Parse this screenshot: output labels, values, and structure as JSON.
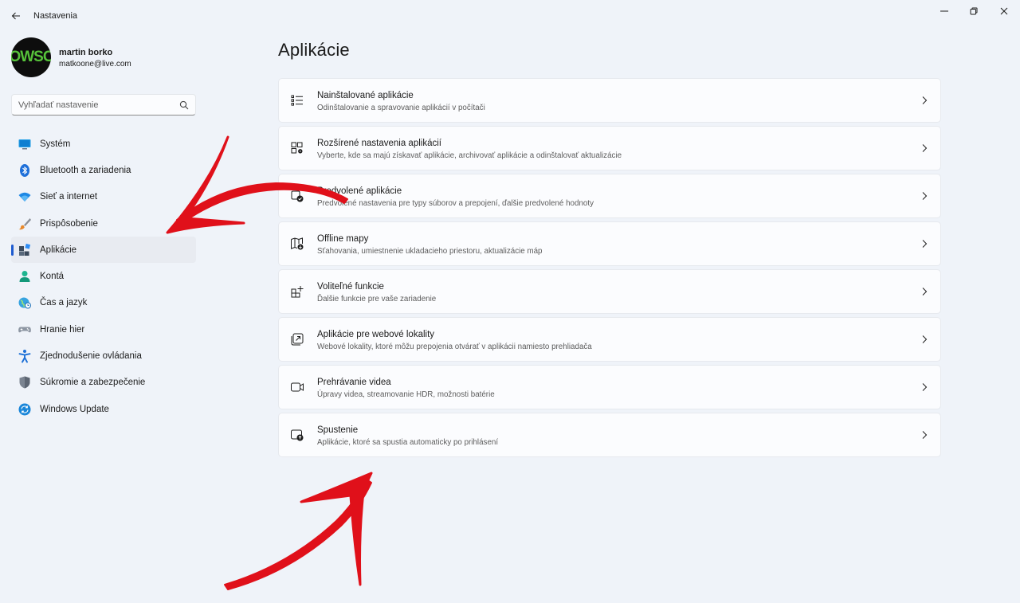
{
  "window": {
    "title": "Nastavenia"
  },
  "profile": {
    "avatar_text": "OWSC",
    "name": "martin borko",
    "email": "matkoone@live.com"
  },
  "search": {
    "placeholder": "Vyhľadať nastavenie"
  },
  "sidebar": {
    "items": [
      {
        "label": "Systém",
        "icon": "monitor-icon"
      },
      {
        "label": "Bluetooth a zariadenia",
        "icon": "bluetooth-icon"
      },
      {
        "label": "Sieť a internet",
        "icon": "wifi-icon"
      },
      {
        "label": "Prispôsobenie",
        "icon": "brush-icon"
      },
      {
        "label": "Aplikácie",
        "icon": "apps-icon",
        "active": true
      },
      {
        "label": "Kontá",
        "icon": "person-icon"
      },
      {
        "label": "Čas a jazyk",
        "icon": "globe-clock-icon"
      },
      {
        "label": "Hranie hier",
        "icon": "gamepad-icon"
      },
      {
        "label": "Zjednodušenie ovládania",
        "icon": "accessibility-icon"
      },
      {
        "label": "Súkromie a zabezpečenie",
        "icon": "shield-icon"
      },
      {
        "label": "Windows Update",
        "icon": "sync-icon"
      }
    ]
  },
  "main": {
    "title": "Aplikácie",
    "cards": [
      {
        "title": "Nainštalované aplikácie",
        "desc": "Odinštalovanie a spravovanie aplikácií v počítači",
        "icon": "list-icon"
      },
      {
        "title": "Rozšírené nastavenia aplikácií",
        "desc": "Vyberte, kde sa majú získavať aplikácie, archivovať aplikácie a odinštalovať aktualizácie",
        "icon": "apps-settings-icon"
      },
      {
        "title": "Predvolené aplikácie",
        "desc": "Predvolené nastavenia pre typy súborov a prepojení, ďalšie predvolené hodnoty",
        "icon": "default-apps-icon"
      },
      {
        "title": "Offline mapy",
        "desc": "Sťahovania, umiestnenie ukladacieho priestoru, aktualizácie máp",
        "icon": "map-download-icon"
      },
      {
        "title": "Voliteľné funkcie",
        "desc": "Ďalšie funkcie pre vaše zariadenie",
        "icon": "add-apps-icon"
      },
      {
        "title": "Aplikácie pre webové lokality",
        "desc": "Webové lokality, ktoré môžu prepojenia otvárať v aplikácii namiesto prehliadača",
        "icon": "open-in-app-icon"
      },
      {
        "title": "Prehrávanie videa",
        "desc": "Úpravy videa, streamovanie HDR, možnosti batérie",
        "icon": "video-icon"
      },
      {
        "title": "Spustenie",
        "desc": "Aplikácie, ktoré sa spustia automaticky po prihlásení",
        "icon": "startup-icon"
      }
    ]
  },
  "colors": {
    "accent": "#1e5bcf",
    "annotation_arrow": "#e0101a"
  }
}
